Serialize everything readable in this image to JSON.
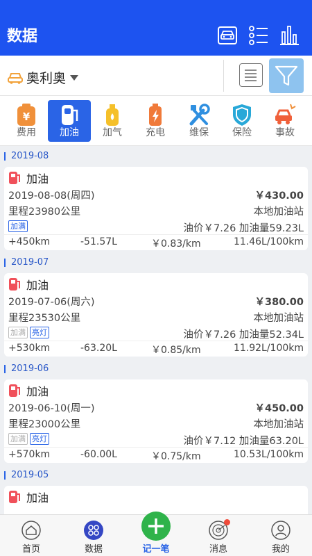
{
  "header": {
    "title": "数据"
  },
  "car": {
    "name": "奥利奥"
  },
  "categories": [
    {
      "label": "费用"
    },
    {
      "label": "加油"
    },
    {
      "label": "加气"
    },
    {
      "label": "充电"
    },
    {
      "label": "维保"
    },
    {
      "label": "保险"
    },
    {
      "label": "事故"
    }
  ],
  "records": [
    {
      "month": "2019-08",
      "type": "加油",
      "date": "2019-08-08(周四)",
      "amount": "￥430.00",
      "mileage": "里程23980公里",
      "station": "本地加油站",
      "tags": [
        "加满"
      ],
      "price_volume": "油价￥7.26 加油量59.23L",
      "delta_km": "+450km",
      "delta_l": "-51.57L",
      "cost_per_km": "￥0.83/km",
      "consumption": "11.46L/100km"
    },
    {
      "month": "2019-07",
      "type": "加油",
      "date": "2019-07-06(周六)",
      "amount": "￥380.00",
      "mileage": "里程23530公里",
      "station": "本地加油站",
      "tags": [
        "加满",
        "亮灯"
      ],
      "price_volume": "油价￥7.26 加油量52.34L",
      "delta_km": "+530km",
      "delta_l": "-63.20L",
      "cost_per_km": "￥0.85/km",
      "consumption": "11.92L/100km"
    },
    {
      "month": "2019-06",
      "type": "加油",
      "date": "2019-06-10(周一)",
      "amount": "￥450.00",
      "mileage": "里程23000公里",
      "station": "本地加油站",
      "tags": [
        "加满",
        "亮灯"
      ],
      "price_volume": "油价￥7.12 加油量63.20L",
      "delta_km": "+570km",
      "delta_l": "-60.00L",
      "cost_per_km": "￥0.75/km",
      "consumption": "10.53L/100km"
    },
    {
      "month": "2019-05",
      "type": "加油"
    }
  ],
  "nav": [
    {
      "label": "首页"
    },
    {
      "label": "数据"
    },
    {
      "label": "记一笔"
    },
    {
      "label": "消息"
    },
    {
      "label": "我的"
    }
  ],
  "colors": {
    "brand": "#1d53f0",
    "active_tab": "#2a64e6",
    "tag_blue": "#2a64e6",
    "fuel_red": "#f0505a",
    "filter_bg": "#8ec3ef",
    "add_green": "#2fb34a"
  }
}
